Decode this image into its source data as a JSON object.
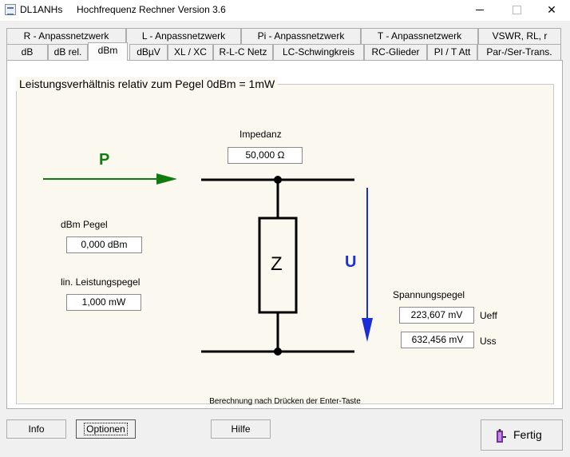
{
  "window": {
    "app_name": "DL1ANHs",
    "title": "Hochfrequenz Rechner Version 3.6",
    "minimize": "—",
    "maximize": "☐",
    "close": "✕"
  },
  "tabs_row1": [
    "R - Anpassnetzwerk",
    "L - Anpassnetzwerk",
    "Pi - Anpassnetzwerk",
    "T - Anpassnetzwerk",
    "VSWR, RL, r"
  ],
  "tabs_row2": [
    "dB",
    "dB rel.",
    "dBm",
    "dBµV",
    "XL / XC",
    "R-L-C Netz",
    "LC-Schwingkreis",
    "RC-Glieder",
    "PI / T Att",
    "Par-/Ser-Trans."
  ],
  "active_tab": "dBm",
  "group_title": "Leistungsverhältnis relativ zum Pegel   0dBm = 1mW",
  "impedance": {
    "label": "Impedanz",
    "value": "50,000 Ω"
  },
  "power_arrow_label": "P",
  "voltage_arrow_label": "U",
  "resistor_label": "Z",
  "dbm_level": {
    "label": "dBm Pegel",
    "value": "0,000 dBm"
  },
  "linear_power": {
    "label": "lin. Leistungspegel",
    "value": "1,000 mW"
  },
  "voltage_level": {
    "label": "Spannungspegel",
    "ueff_value": "223,607 mV",
    "ueff_unit": "Ueff",
    "uss_value": "632,456 mV",
    "uss_unit": "Uss"
  },
  "note": "Berechnung  nach Drücken der Enter-Taste",
  "buttons": {
    "info": "Info",
    "optionen": "Optionen",
    "hilfe": "Hilfe",
    "fertig": "Fertig"
  },
  "colors": {
    "power_arrow": "#107c10",
    "voltage_arrow": "#1a2fd6",
    "panel_bg": "#fbf9ef"
  }
}
